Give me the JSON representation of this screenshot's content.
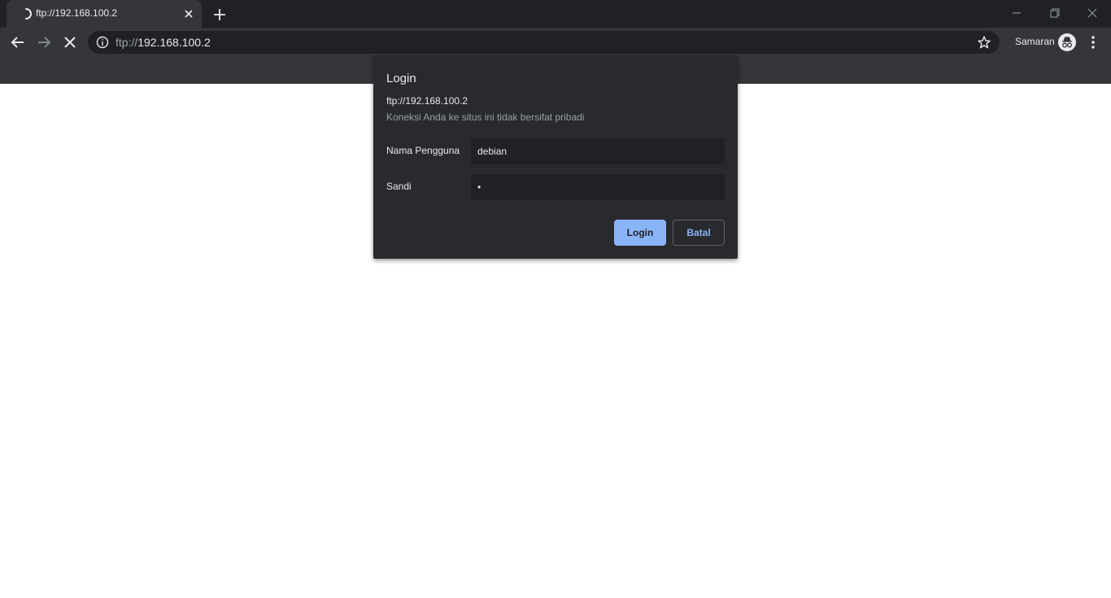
{
  "tab": {
    "title": "ftp://192.168.100.2",
    "spinner_icon": "loading-spinner-icon",
    "close_icon": "close-icon"
  },
  "toolbar": {
    "url_scheme": "ftp://",
    "url_host": "192.168.100.2",
    "profile_label": "Samaran"
  },
  "dialog": {
    "title": "Login",
    "host": "ftp://192.168.100.2",
    "warning": "Koneksi Anda ke situs ini tidak bersifat pribadi",
    "username_label": "Nama Pengguna",
    "username_value": "debian",
    "password_label": "Sandi",
    "password_value": "•",
    "login_button": "Login",
    "cancel_button": "Batal"
  },
  "colors": {
    "accent": "#8ab4f8",
    "frame": "#202124",
    "toolbar": "#35363a",
    "dialog": "#292a2d"
  }
}
